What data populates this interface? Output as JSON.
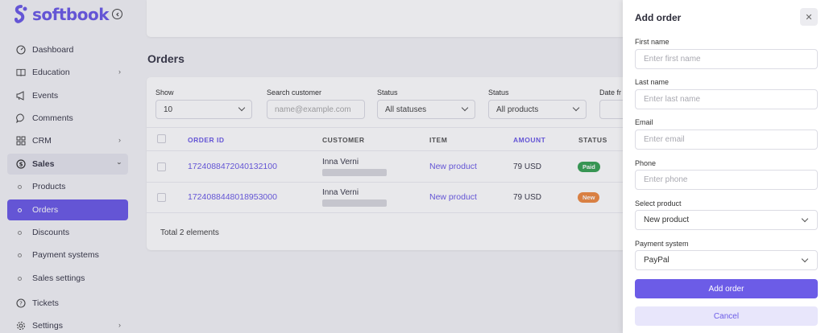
{
  "app": {
    "name": "softbook",
    "brand_color": "#6c5ce7"
  },
  "sidebar": {
    "items": [
      {
        "label": "Dashboard",
        "icon": "dashboard-icon"
      },
      {
        "label": "Education",
        "icon": "book-icon",
        "chevron": true
      },
      {
        "label": "Events",
        "icon": "megaphone-icon"
      },
      {
        "label": "Comments",
        "icon": "comment-icon"
      },
      {
        "label": "CRM",
        "icon": "grid-icon",
        "chevron": true
      },
      {
        "label": "Sales",
        "icon": "dollar-icon",
        "expanded": true
      },
      {
        "label": "Products",
        "sub": true
      },
      {
        "label": "Orders",
        "sub": true,
        "active": true
      },
      {
        "label": "Discounts",
        "sub": true
      },
      {
        "label": "Payment systems",
        "sub": true
      },
      {
        "label": "Sales settings",
        "sub": true
      },
      {
        "label": "Tickets",
        "icon": "help-icon"
      },
      {
        "label": "Settings",
        "icon": "gear-icon",
        "chevron": true
      }
    ]
  },
  "main": {
    "title": "Orders",
    "filters": {
      "show": {
        "label": "Show",
        "value": "10"
      },
      "search": {
        "label": "Search customer",
        "placeholder": "name@example.com"
      },
      "status": {
        "label": "Status",
        "value": "All statuses"
      },
      "product": {
        "label": "Status",
        "value": "All products"
      },
      "date": {
        "label": "Date fr"
      }
    },
    "table": {
      "headers": {
        "order_id": "ORDER ID",
        "customer": "CUSTOMER",
        "item": "ITEM",
        "amount": "AMOUNT",
        "status": "STATUS"
      },
      "rows": [
        {
          "order_id": "1724088472040132100",
          "customer": "Inna Verni",
          "item": "New product",
          "amount": "79 USD",
          "status": "Paid"
        },
        {
          "order_id": "1724088448018953000",
          "customer": "Inna Verni",
          "item": "New product",
          "amount": "79 USD",
          "status": "New"
        }
      ]
    },
    "total": "Total 2 elements"
  },
  "drawer": {
    "title": "Add order",
    "fields": {
      "first_name": {
        "label": "First name",
        "placeholder": "Enter first name"
      },
      "last_name": {
        "label": "Last name",
        "placeholder": "Enter last name"
      },
      "email": {
        "label": "Email",
        "placeholder": "Enter email"
      },
      "phone": {
        "label": "Phone",
        "placeholder": "Enter phone"
      },
      "product": {
        "label": "Select product",
        "value": "New product"
      },
      "payment": {
        "label": "Payment system",
        "value": "PayPal"
      }
    },
    "submit_label": "Add order",
    "cancel_label": "Cancel"
  }
}
